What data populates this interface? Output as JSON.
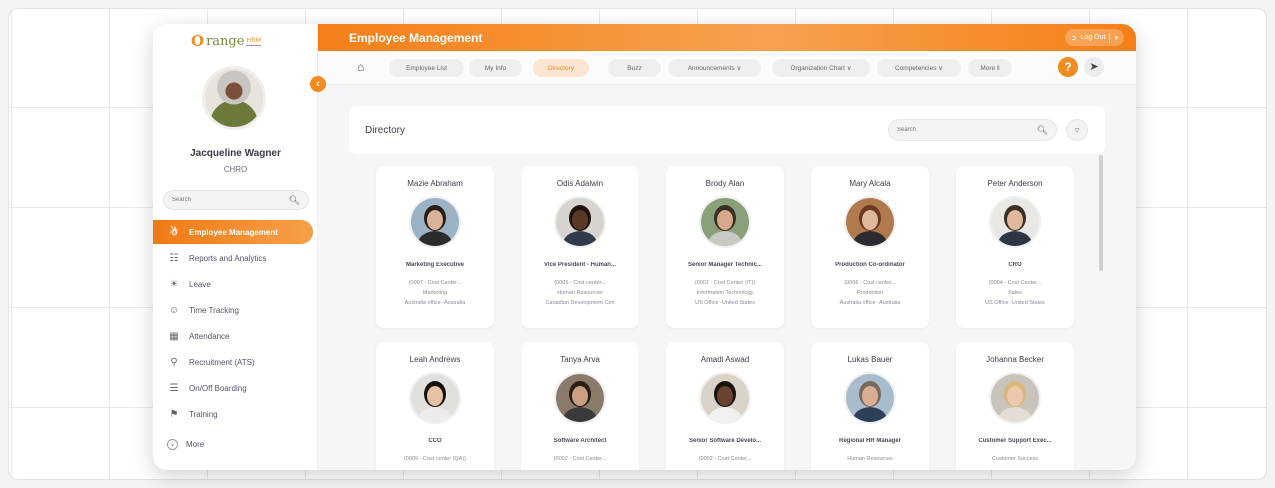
{
  "brand": {
    "logo_o": "O",
    "logo_text": "range",
    "logo_hrm": "HRM"
  },
  "user": {
    "name": "Jacqueline Wagner",
    "role": "CHRO"
  },
  "sidebar": {
    "search_placeholder": "Search",
    "items": [
      {
        "label": "Employee Management",
        "icon": "employee-mgmt-icon",
        "active": true
      },
      {
        "label": "Reports and Analytics",
        "icon": "reports-icon"
      },
      {
        "label": "Leave",
        "icon": "leave-icon"
      },
      {
        "label": "Time Tracking",
        "icon": "time-tracking-icon"
      },
      {
        "label": "Attendance",
        "icon": "attendance-icon"
      },
      {
        "label": "Recruitment (ATS)",
        "icon": "recruitment-icon"
      },
      {
        "label": "On/Off Boarding",
        "icon": "onboarding-icon"
      },
      {
        "label": "Training",
        "icon": "training-icon"
      },
      {
        "label": "More",
        "icon": "chevron-down-icon"
      }
    ]
  },
  "header": {
    "title": "Employee Management",
    "logout_label": "Log Out"
  },
  "nav": {
    "tabs": [
      {
        "label": "Employee List"
      },
      {
        "label": "My Info"
      },
      {
        "label": "Directory",
        "active": true
      },
      {
        "label": "Buzz"
      },
      {
        "label": "Announcements ∨"
      },
      {
        "label": "Organization Chart ∨"
      },
      {
        "label": "Competencies ∨"
      },
      {
        "label": "More ‖"
      }
    ],
    "help": "?"
  },
  "directory": {
    "title": "Directory",
    "search_placeholder": "Search",
    "cards": [
      {
        "name": "Mazie Abraham",
        "title": "Marketing Executive",
        "line1": "(0007 - Cost Center...",
        "line2": "Marketing",
        "line3": "Australia office -Australia",
        "skin": "#d9b39a",
        "hair": "#2a1d16",
        "shirt": "#2b2b2b",
        "bg": "#9bb3c4"
      },
      {
        "name": "Odis Adalwin",
        "title": "Vice President - Human...",
        "line1": "(0005 - Cost center...",
        "line2": "Human Resources",
        "line3": "Canadian Development Cen",
        "skin": "#5a3826",
        "hair": "#1d1410",
        "shirt": "#2f3a4a",
        "bg": "#d7d4d0"
      },
      {
        "name": "Brody Alan",
        "title": "Senior Manager Technic...",
        "line1": "(0001 - Cost Center (IT))",
        "line2": "Information Technology",
        "line3": "US Office -United States",
        "skin": "#d6a88c",
        "hair": "#3a2f25",
        "shirt": "#c9c9c4",
        "bg": "#8aa07a"
      },
      {
        "name": "Mary Alcala",
        "title": "Production Co-ordinator",
        "line1": "(0006 - Cost center...",
        "line2": "Production",
        "line3": "Australia office -Australia",
        "skin": "#e0b89c",
        "hair": "#6a3a20",
        "shirt": "#2c2c30",
        "bg": "#b07a4c"
      },
      {
        "name": "Peter Anderson",
        "title": "CRO",
        "line1": "(0004 - Cost Center...",
        "line2": "Sales",
        "line3": "US Office -United States",
        "skin": "#e1b89e",
        "hair": "#3b2f26",
        "shirt": "#2d3645",
        "bg": "#e9e7e3"
      },
      {
        "name": "Leah Andrews",
        "title": "CCO",
        "line1": "(0009 - Cost center (QA))",
        "line2": "",
        "line3": "",
        "skin": "#e6c2a4",
        "hair": "#141110",
        "shirt": "#ececec",
        "bg": "#e2e0dd"
      },
      {
        "name": "Tanya Arva",
        "title": "Software Architect",
        "line1": "(0002 - Cost Center...",
        "line2": "",
        "line3": "",
        "skin": "#caa082",
        "hair": "#2b1e17",
        "shirt": "#3a3a3a",
        "bg": "#8a7a6a"
      },
      {
        "name": "Amadi Aswad",
        "title": "Senior Software Develo...",
        "line1": "(0002 - Cost Center...",
        "line2": "",
        "line3": "",
        "skin": "#6a4230",
        "hair": "#1a120e",
        "shirt": "#f0f0ee",
        "bg": "#d8d2c8"
      },
      {
        "name": "Lukas Bauer",
        "title": "Regional HR Manager",
        "line1": "Human Resources",
        "line2": "",
        "line3": "",
        "skin": "#d9ae94",
        "hair": "#7a6a5c",
        "shirt": "#2e4058",
        "bg": "#a9bccb"
      },
      {
        "name": "Johanna Becker",
        "title": "Customer Support Exec...",
        "line1": "Customer Success",
        "line2": "",
        "line3": "",
        "skin": "#ecc8ae",
        "hair": "#d7b77c",
        "shirt": "#e3ddd3",
        "bg": "#c8c4bc"
      }
    ]
  }
}
